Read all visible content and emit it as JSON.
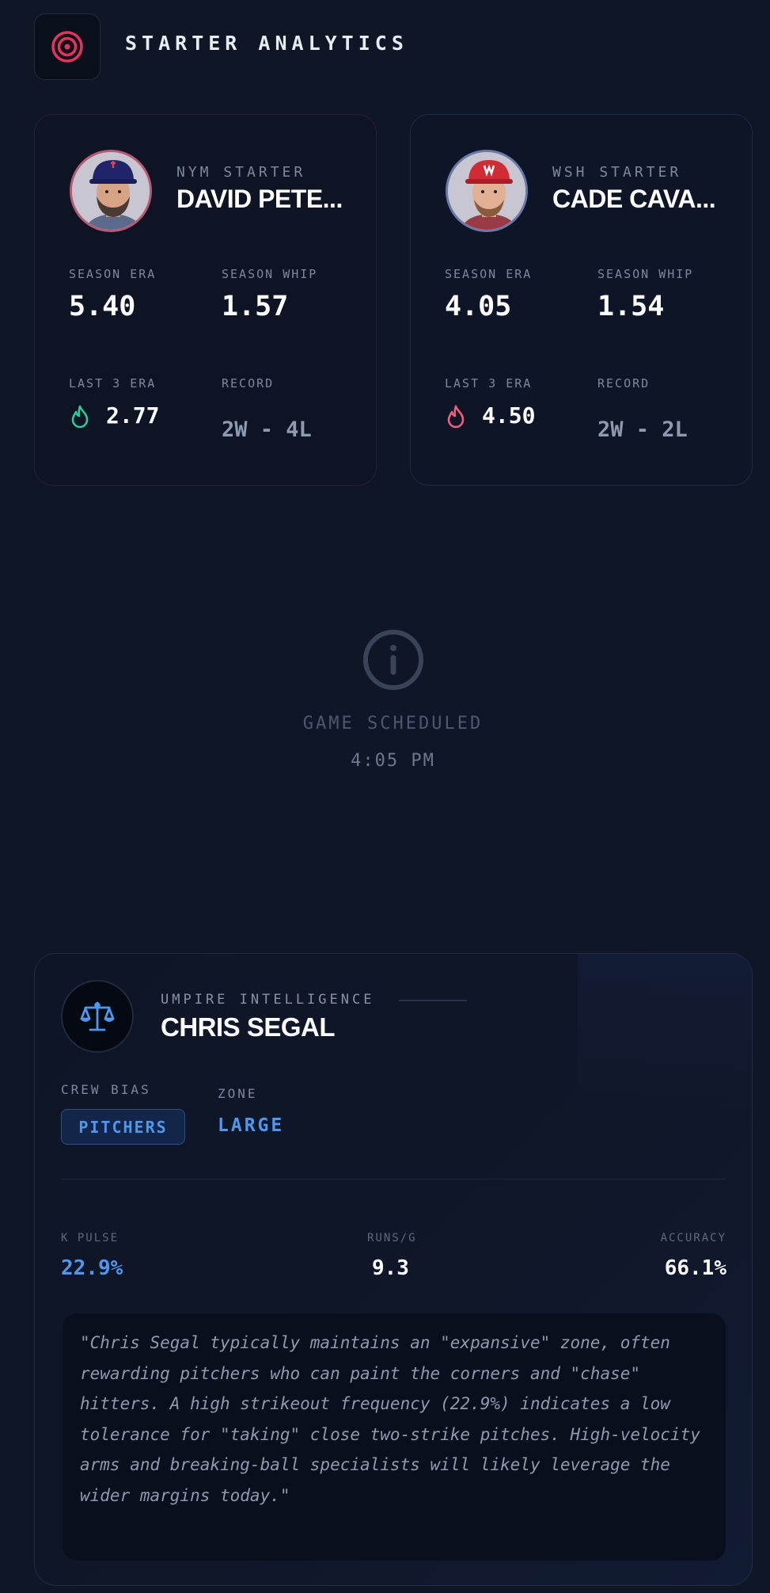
{
  "header": {
    "title": "STARTER ANALYTICS",
    "logo_icon": "target-icon",
    "accent_color": "#e8325a"
  },
  "pitchers": [
    {
      "team_label": "NYM STARTER",
      "name": "DAVID PETE...",
      "season_era_label": "SEASON ERA",
      "season_era": "5.40",
      "season_whip_label": "SEASON WHIP",
      "season_whip": "1.57",
      "last3_era_label": "LAST 3 ERA",
      "last3_era": "2.77",
      "trend_icon": "flame-icon",
      "trend_color": "#2fc89a",
      "record_label": "RECORD",
      "record": "2W - 4L"
    },
    {
      "team_label": "WSH STARTER",
      "name": "CADE CAVA...",
      "season_era_label": "SEASON ERA",
      "season_era": "4.05",
      "season_whip_label": "SEASON WHIP",
      "season_whip": "1.54",
      "last3_era_label": "LAST 3 ERA",
      "last3_era": "4.50",
      "trend_icon": "flame-icon",
      "trend_color": "#f0607a",
      "record_label": "RECORD",
      "record": "2W - 2L"
    }
  ],
  "game": {
    "status_icon": "info-icon",
    "status": "GAME SCHEDULED",
    "time": "4:05 PM"
  },
  "umpire": {
    "icon": "scales-icon",
    "kicker": "UMPIRE INTELLIGENCE",
    "name": "CHRIS SEGAL",
    "crew_bias_label": "CREW BIAS",
    "crew_bias": "PITCHERS",
    "zone_label": "ZONE",
    "zone": "LARGE",
    "k_pulse_label": "K PULSE",
    "k_pulse": "22.9%",
    "runs_label": "RUNS/G",
    "runs": "9.3",
    "accuracy_label": "ACCURACY",
    "accuracy": "66.1%",
    "highlight_color": "#4f96ef",
    "summary": "\"Chris Segal typically maintains an \"expansive\" zone, often rewarding pitchers who can paint the corners and \"chase\" hitters. A high strikeout frequency (22.9%) indicates a low tolerance for \"taking\" close two-strike pitches. High-velocity arms and breaking-ball specialists will likely leverage the wider margins today.\""
  }
}
